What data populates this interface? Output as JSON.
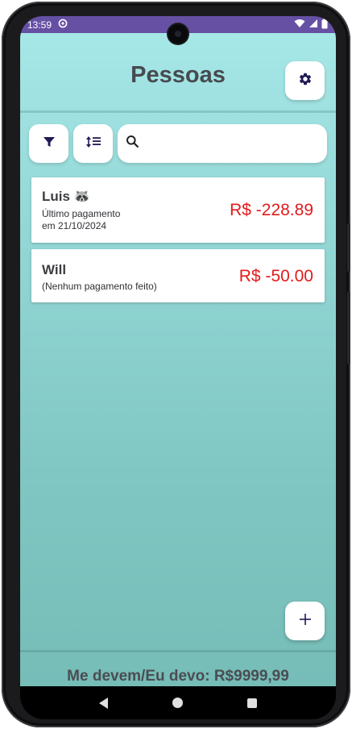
{
  "status_bar": {
    "time": "13:59"
  },
  "header": {
    "title": "Pessoas"
  },
  "search": {
    "placeholder": "",
    "value": ""
  },
  "people": [
    {
      "name": "Luis",
      "emoji": "🦝",
      "subtitle_line1": "Último pagamento",
      "subtitle_line2": "em 21/10/2024",
      "balance": "R$ -228.89"
    },
    {
      "name": "Will",
      "subtitle_line1": "(Nenhum pagamento feito)",
      "balance": "R$ -50.00"
    }
  ],
  "footer": {
    "summary": "Me devem/Eu devo: R$9999,99"
  },
  "colors": {
    "status_bar": "#6650a4",
    "negative_amount": "#e31b1b",
    "icon": "#1f1a55",
    "background_top": "#a6e7e7",
    "background_bottom": "#76bcb7"
  },
  "icons": {
    "settings": "gear-icon",
    "filter": "filter-icon",
    "sort": "sort-icon",
    "search": "search-icon",
    "add": "plus-icon"
  }
}
